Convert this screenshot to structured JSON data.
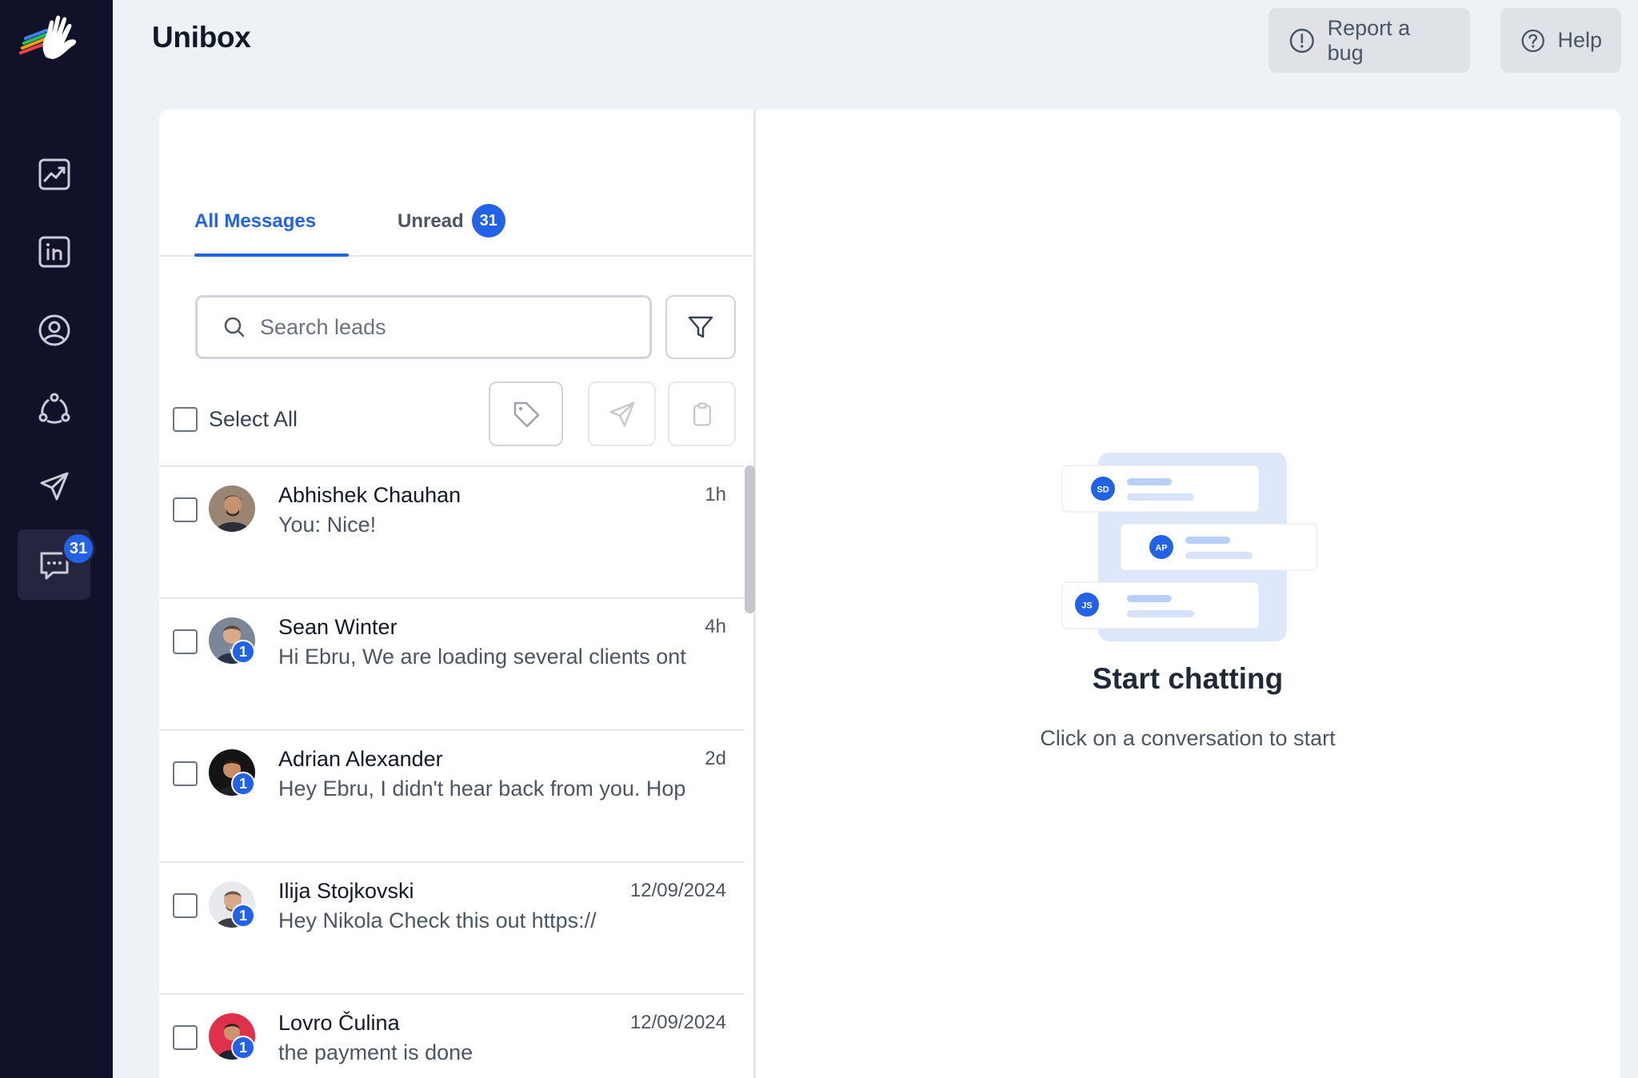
{
  "app": {
    "page_title": "Unibox"
  },
  "sidebar": {
    "items": [
      {
        "icon": "analytics-icon"
      },
      {
        "icon": "linkedin-icon"
      },
      {
        "icon": "profile-icon"
      },
      {
        "icon": "network-icon"
      },
      {
        "icon": "send-icon"
      },
      {
        "icon": "chat-icon",
        "badge": "31",
        "active": true
      }
    ]
  },
  "header": {
    "report_bug_label": "Report a bug",
    "help_label": "Help"
  },
  "tabs": {
    "all_label": "All Messages",
    "unread_label": "Unread",
    "unread_count": "31"
  },
  "search": {
    "placeholder": "Search leads",
    "value": ""
  },
  "toolbar": {
    "select_all_label": "Select All"
  },
  "conversations": [
    {
      "name": "Abhishek Chauhan",
      "preview": "You: Nice!",
      "time": "1h",
      "unread_badge": ""
    },
    {
      "name": "Sean Winter",
      "preview": "Hi Ebru, We are loading several clients ont",
      "time": "4h",
      "unread_badge": "1"
    },
    {
      "name": "Adrian Alexander",
      "preview": "Hey Ebru, I didn't hear back from you. Hop",
      "time": "2d",
      "unread_badge": "1"
    },
    {
      "name": "Ilija Stojkovski",
      "preview": "Hey Nikola Check this out https://",
      "time": "12/09/2024",
      "unread_badge": "1"
    },
    {
      "name": "Lovro Čulina",
      "preview": "the payment is done",
      "time": "12/09/2024",
      "unread_badge": "1"
    }
  ],
  "empty_state": {
    "title": "Start chatting",
    "subtitle": "Click on a conversation to start",
    "illustration_initials": [
      "SD",
      "AP",
      "JS"
    ]
  },
  "colors": {
    "accent": "#2162e6",
    "sidebar_bg": "#12112a",
    "page_bg": "#eef1f5"
  }
}
